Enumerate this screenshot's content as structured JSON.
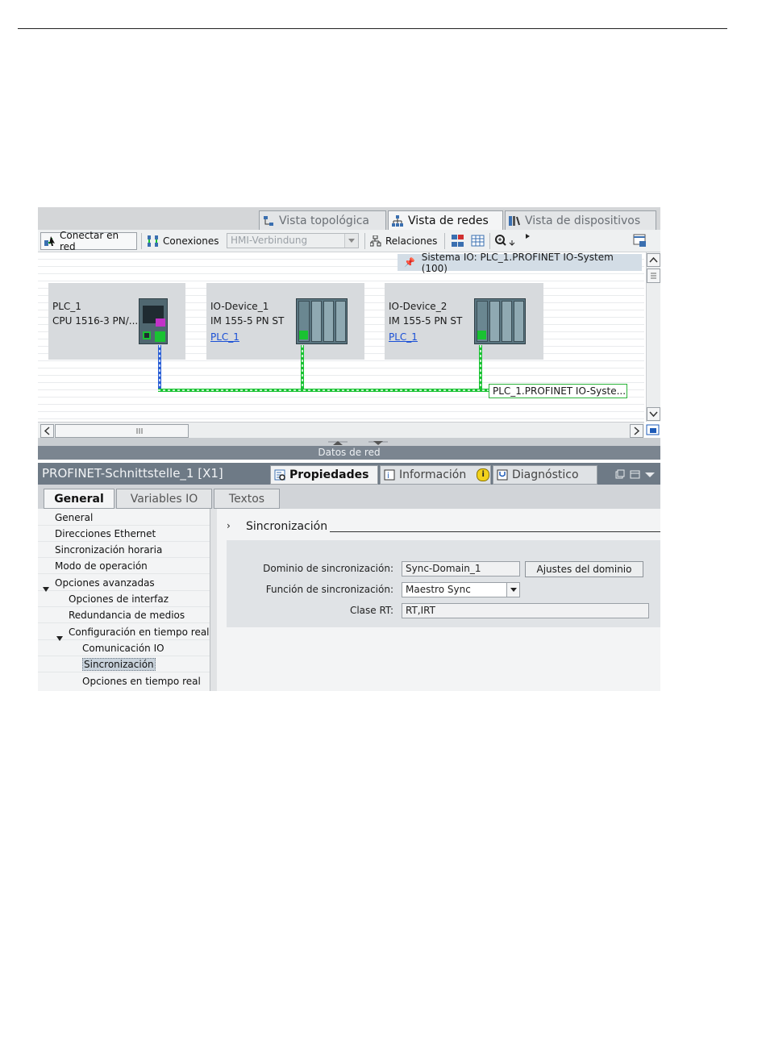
{
  "top_tabs": [
    {
      "label": "Vista topológica",
      "icon": "topology-icon",
      "active": false
    },
    {
      "label": "Vista de redes",
      "icon": "network-icon",
      "active": true
    },
    {
      "label": "Vista de dispositivos",
      "icon": "device-icon",
      "active": false
    }
  ],
  "toolbar": {
    "connect_label": "Conectar en red",
    "connections_label": "Conexiones",
    "connection_type": "HMI-Verbindung",
    "relations_label": "Relaciones"
  },
  "io_system_banner": "Sistema IO: PLC_1.PROFINET IO-System (100)",
  "devices": [
    {
      "name": "PLC_1",
      "type": "CPU 1516-3 PN/...",
      "link": ""
    },
    {
      "name": "IO-Device_1",
      "type": "IM 155-5 PN ST",
      "link": "PLC_1"
    },
    {
      "name": "IO-Device_2",
      "type": "IM 155-5 PN ST",
      "link": "PLC_1"
    }
  ],
  "network_label": "PLC_1.PROFINET IO-Syste...",
  "net_data_label": "Datos de red",
  "properties": {
    "title": "PROFINET-Schnittstelle_1 [X1]",
    "tabs": [
      {
        "label": "Propiedades",
        "icon": "properties-icon",
        "active": true
      },
      {
        "label": "Información",
        "icon": "info-icon",
        "active": false
      },
      {
        "label": "Diagnóstico",
        "icon": "diagnostics-icon",
        "active": false
      }
    ],
    "subtabs": [
      {
        "label": "General",
        "active": true
      },
      {
        "label": "Variables IO",
        "active": false
      },
      {
        "label": "Textos",
        "active": false
      }
    ]
  },
  "nav": [
    {
      "label": "General",
      "indent": 0
    },
    {
      "label": "Direcciones Ethernet",
      "indent": 0
    },
    {
      "label": "Sincronización horaria",
      "indent": 0
    },
    {
      "label": "Modo de operación",
      "indent": 0
    },
    {
      "label": "Opciones avanzadas",
      "indent": 0,
      "expanded": true
    },
    {
      "label": "Opciones de interfaz",
      "indent": 1
    },
    {
      "label": "Redundancia de medios",
      "indent": 1
    },
    {
      "label": "Configuración en tiempo real",
      "indent": 1,
      "expanded": true
    },
    {
      "label": "Comunicación IO",
      "indent": 2
    },
    {
      "label": "Sincronización",
      "indent": 2,
      "selected": true
    },
    {
      "label": "Opciones en tiempo real",
      "indent": 2
    }
  ],
  "section": {
    "title": "Sincronización",
    "domain_label": "Dominio de sincronización:",
    "domain_value": "Sync-Domain_1",
    "domain_button": "Ajustes del dominio",
    "function_label": "Función de sincronización:",
    "function_value": "Maestro Sync",
    "rt_label": "Clase RT:",
    "rt_value": "RT,IRT"
  },
  "colors": {
    "profinet_line": "#19c232",
    "plc_line": "#2a5fd6",
    "selected_nav": "#c9d3dc"
  }
}
